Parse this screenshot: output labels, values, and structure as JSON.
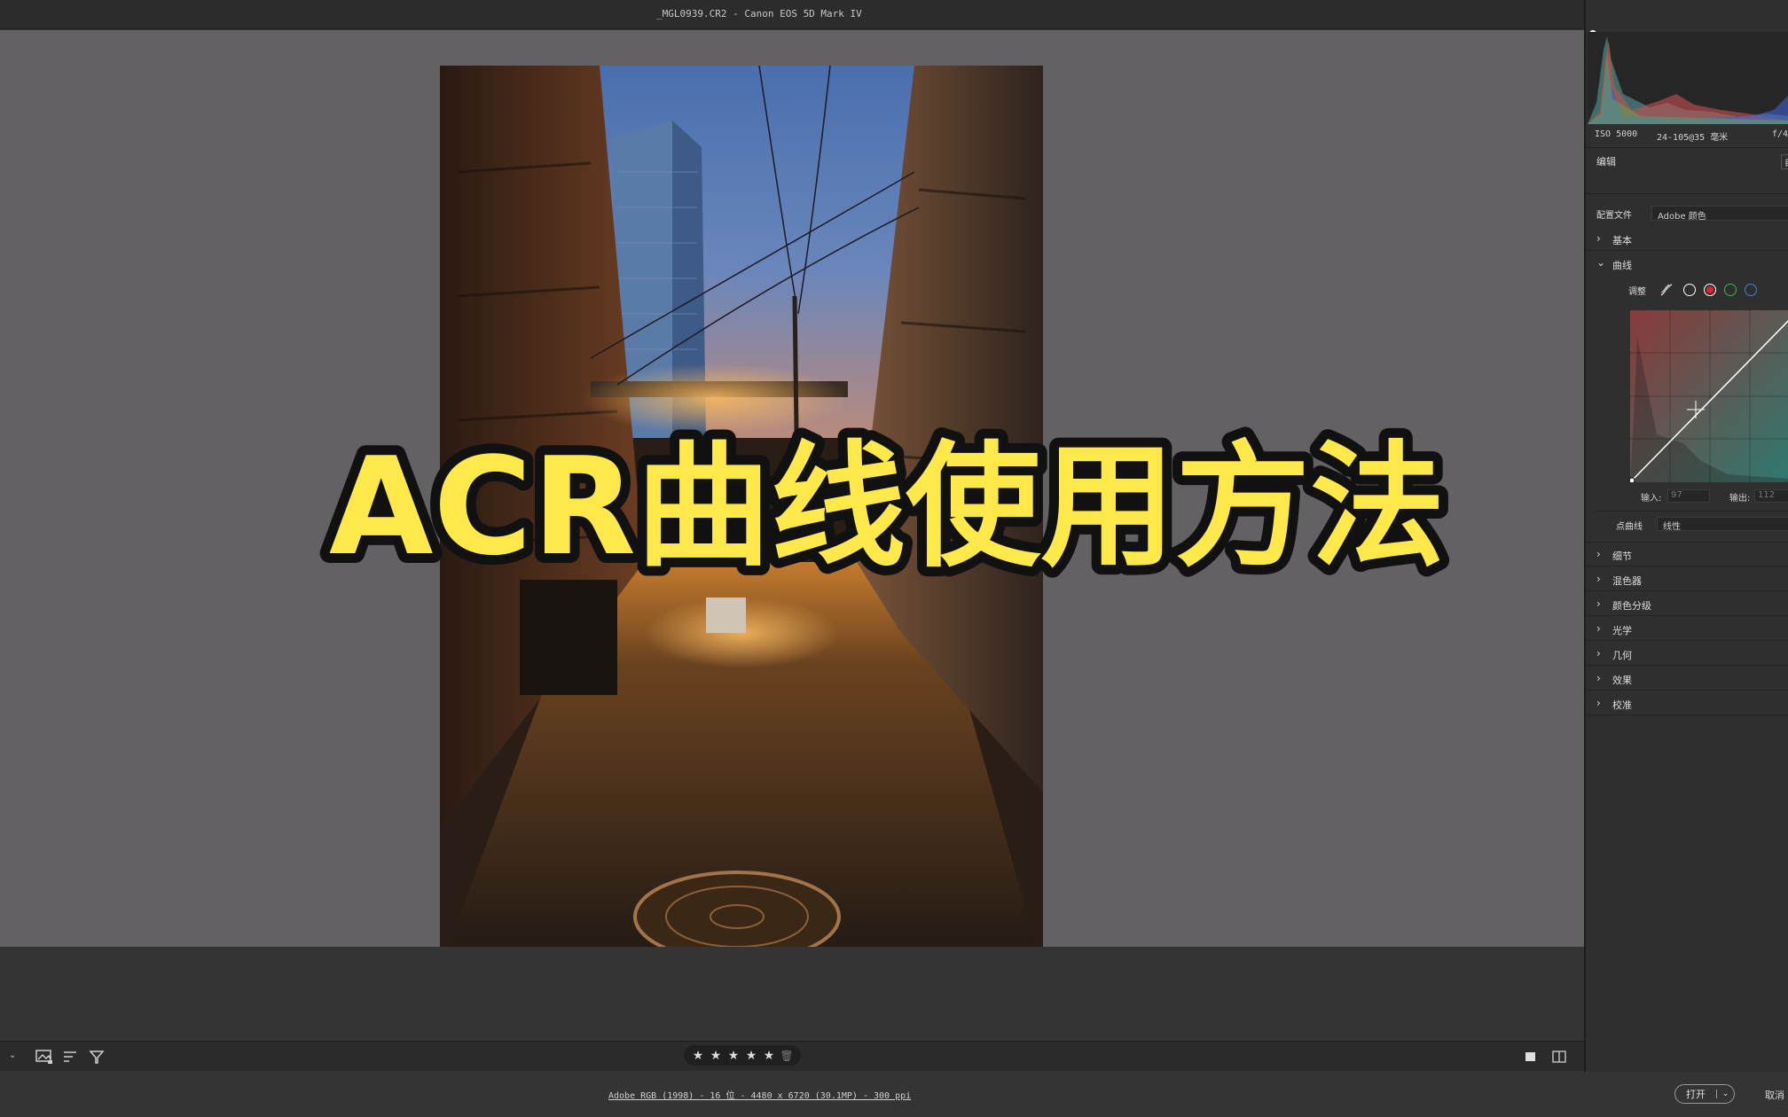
{
  "window": {
    "title": "_MGL0939.CR2 -  Canon EOS 5D Mark IV"
  },
  "overlay": {
    "heading": "ACR曲线使用方法"
  },
  "histogram_meta": {
    "iso": "ISO 5000",
    "lens": "24-105@35 毫米",
    "aperture": "f/4"
  },
  "panel": {
    "edit_label": "编辑",
    "auto_label": "自",
    "profile_label": "配置文件",
    "profile_value": "Adobe 颜色",
    "sections_top": [
      {
        "label": "基本",
        "expanded": false
      },
      {
        "label": "曲线",
        "expanded": true
      }
    ],
    "curve": {
      "adjust_label": "调整",
      "channels": [
        "parametric",
        "white",
        "red",
        "green",
        "blue"
      ],
      "selected_channel": "red",
      "input_label": "输入:",
      "input_value": "97",
      "output_label": "输出:",
      "output_value": "112",
      "point_curve_label": "点曲线",
      "point_curve_value": "线性"
    },
    "sections_bottom": [
      {
        "label": "细节"
      },
      {
        "label": "混色器"
      },
      {
        "label": "颜色分级"
      },
      {
        "label": "光学"
      },
      {
        "label": "几何"
      },
      {
        "label": "效果"
      },
      {
        "label": "校准"
      }
    ]
  },
  "toolbar": {
    "rating_stars": 5,
    "icons": [
      "image-sort-icon",
      "sort-lines-icon",
      "filter-icon",
      "single-view-icon",
      "compare-view-icon"
    ]
  },
  "status": {
    "info": "Adobe RGB (1998) - 16 位 - 4480 x 6720 (30.1MP) - 300 ppi",
    "open_label": "打开",
    "cancel_label": "取消"
  },
  "colors": {
    "overlay_text": "#ffe94a",
    "overlay_outline": "#111111",
    "red_channel": "#e0202a",
    "green_channel": "#3fb649",
    "blue_channel": "#3a82e0"
  }
}
